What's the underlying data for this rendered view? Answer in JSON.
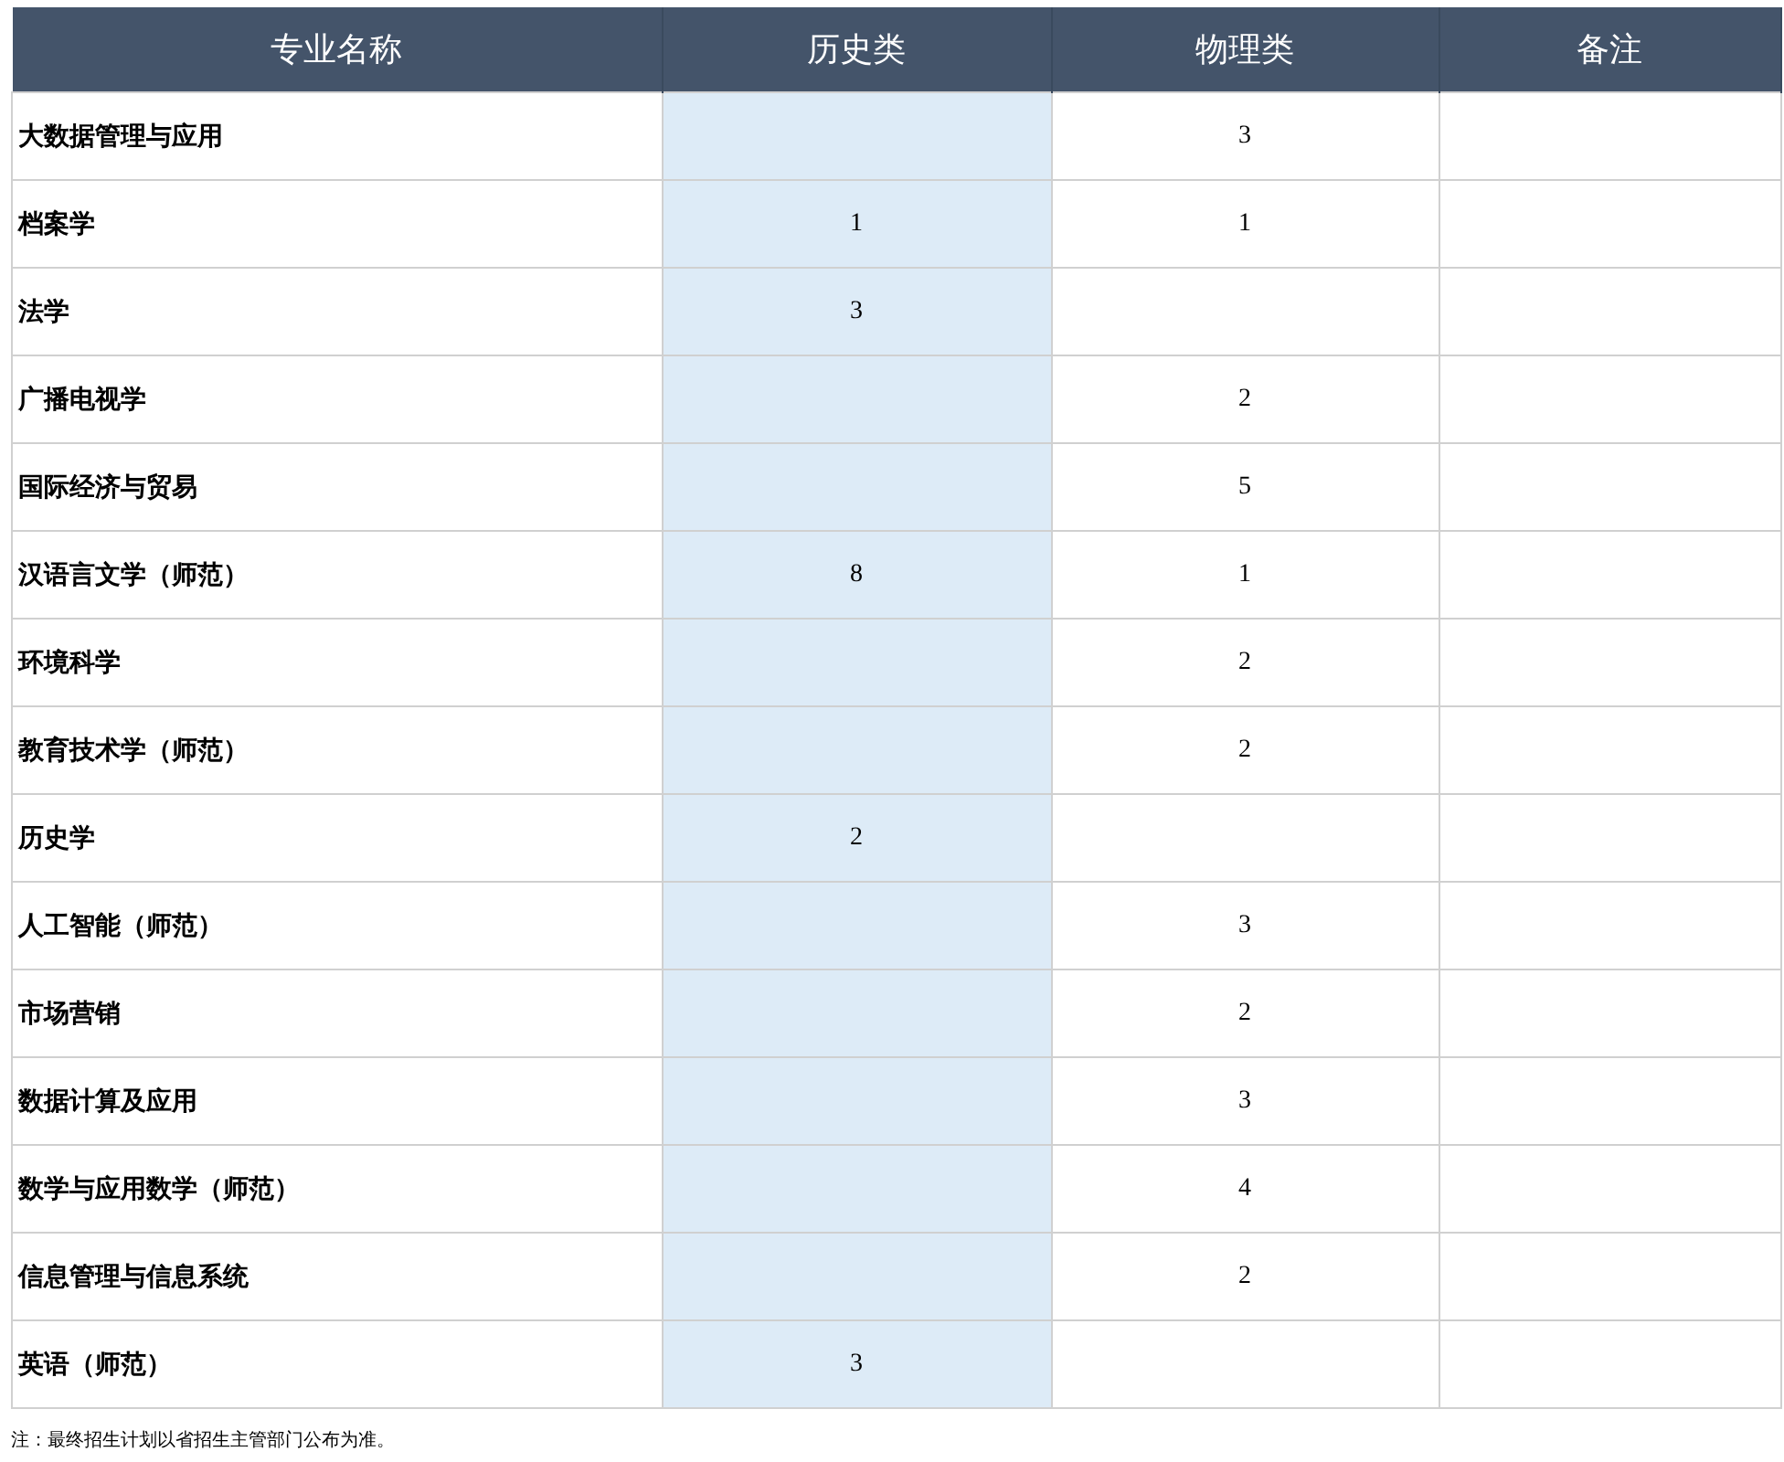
{
  "table": {
    "columns": [
      "专业名称",
      "历史类",
      "物理类",
      "备注"
    ],
    "rows": [
      {
        "name": "大数据管理与应用",
        "physics": "3"
      },
      {
        "name": "档案学",
        "history": "1",
        "physics": "1"
      },
      {
        "name": "法学",
        "history": "3"
      },
      {
        "name": "广播电视学",
        "physics": "2"
      },
      {
        "name": "国际经济与贸易",
        "physics": "5"
      },
      {
        "name": "汉语言文学（师范）",
        "history": "8",
        "physics": "1"
      },
      {
        "name": "环境科学",
        "physics": "2"
      },
      {
        "name": "教育技术学（师范）",
        "physics": "2"
      },
      {
        "name": "历史学",
        "history": "2"
      },
      {
        "name": "人工智能（师范）",
        "physics": "3"
      },
      {
        "name": "市场营销",
        "physics": "2"
      },
      {
        "name": "数据计算及应用",
        "physics": "3"
      },
      {
        "name": "数学与应用数学（师范）",
        "physics": "4"
      },
      {
        "name": "信息管理与信息系统",
        "physics": "2"
      },
      {
        "name": "英语（师范）",
        "history": "3"
      }
    ]
  },
  "note": "注：最终招生计划以省招生主管部门公布为准。"
}
